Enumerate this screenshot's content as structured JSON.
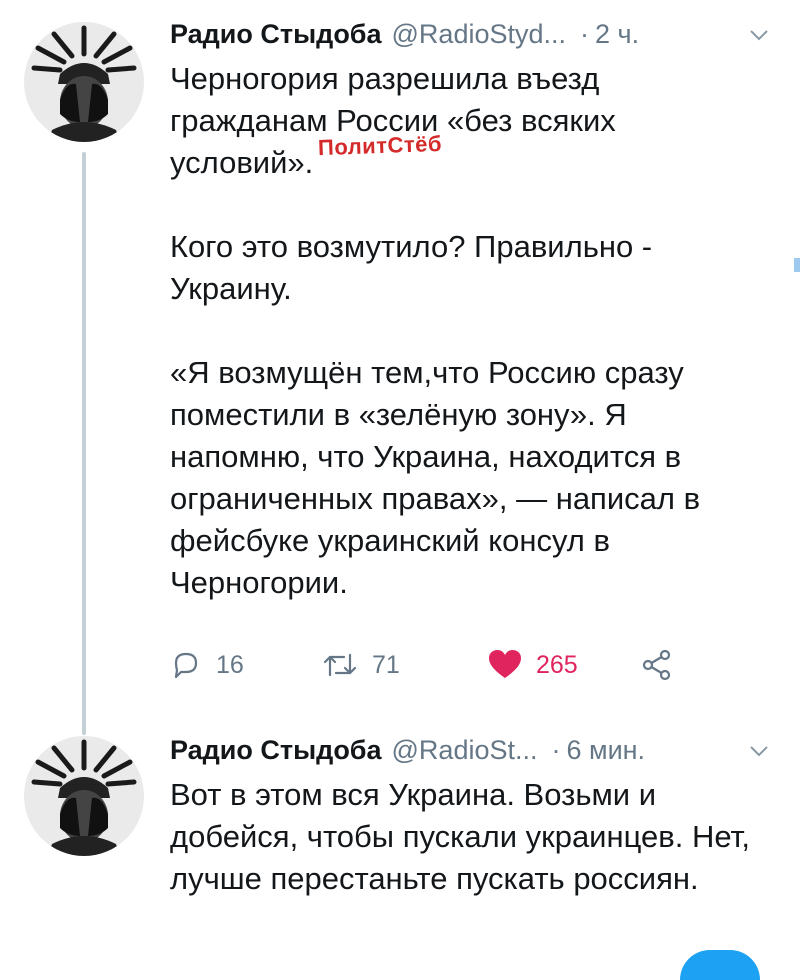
{
  "tweets": [
    {
      "author_name": "Радио Стыдоба",
      "handle": "@RadioStyd...",
      "separator": "·",
      "time": "2 ч.",
      "paragraphs": [
        "Черногория разрешила въезд гражданам России «без всяких условий».",
        "Кого это возмутило? Правильно - Украину.",
        "«Я возмущён тем,что Россию сразу поместили в «зелёную зону». Я напомню, что Украина, находится в ограниченных правах», — написал в фейсбуке украинский консул в Черногории."
      ],
      "watermark": "ПолитСтёб",
      "actions": {
        "reply_count": "16",
        "retweet_count": "71",
        "like_count": "265",
        "liked": true
      },
      "icons": {
        "reply": "reply-icon",
        "retweet": "retweet-icon",
        "like": "heart-icon",
        "share": "share-icon",
        "menu": "chevron-down-icon"
      }
    },
    {
      "author_name": "Радио Стыдоба",
      "handle": "@RadioSt...",
      "separator": "·",
      "time": "6 мин.",
      "paragraphs": [
        "Вот в этом вся Украина. Возьми и добейся, чтобы пускали украинцев. Нет, лучше перестаньте пускать россиян."
      ]
    }
  ],
  "colors": {
    "like_red": "#e0245e",
    "secondary_text": "#657786",
    "watermark_red": "#d42a2a",
    "thread_line": "#c4cfd6"
  }
}
